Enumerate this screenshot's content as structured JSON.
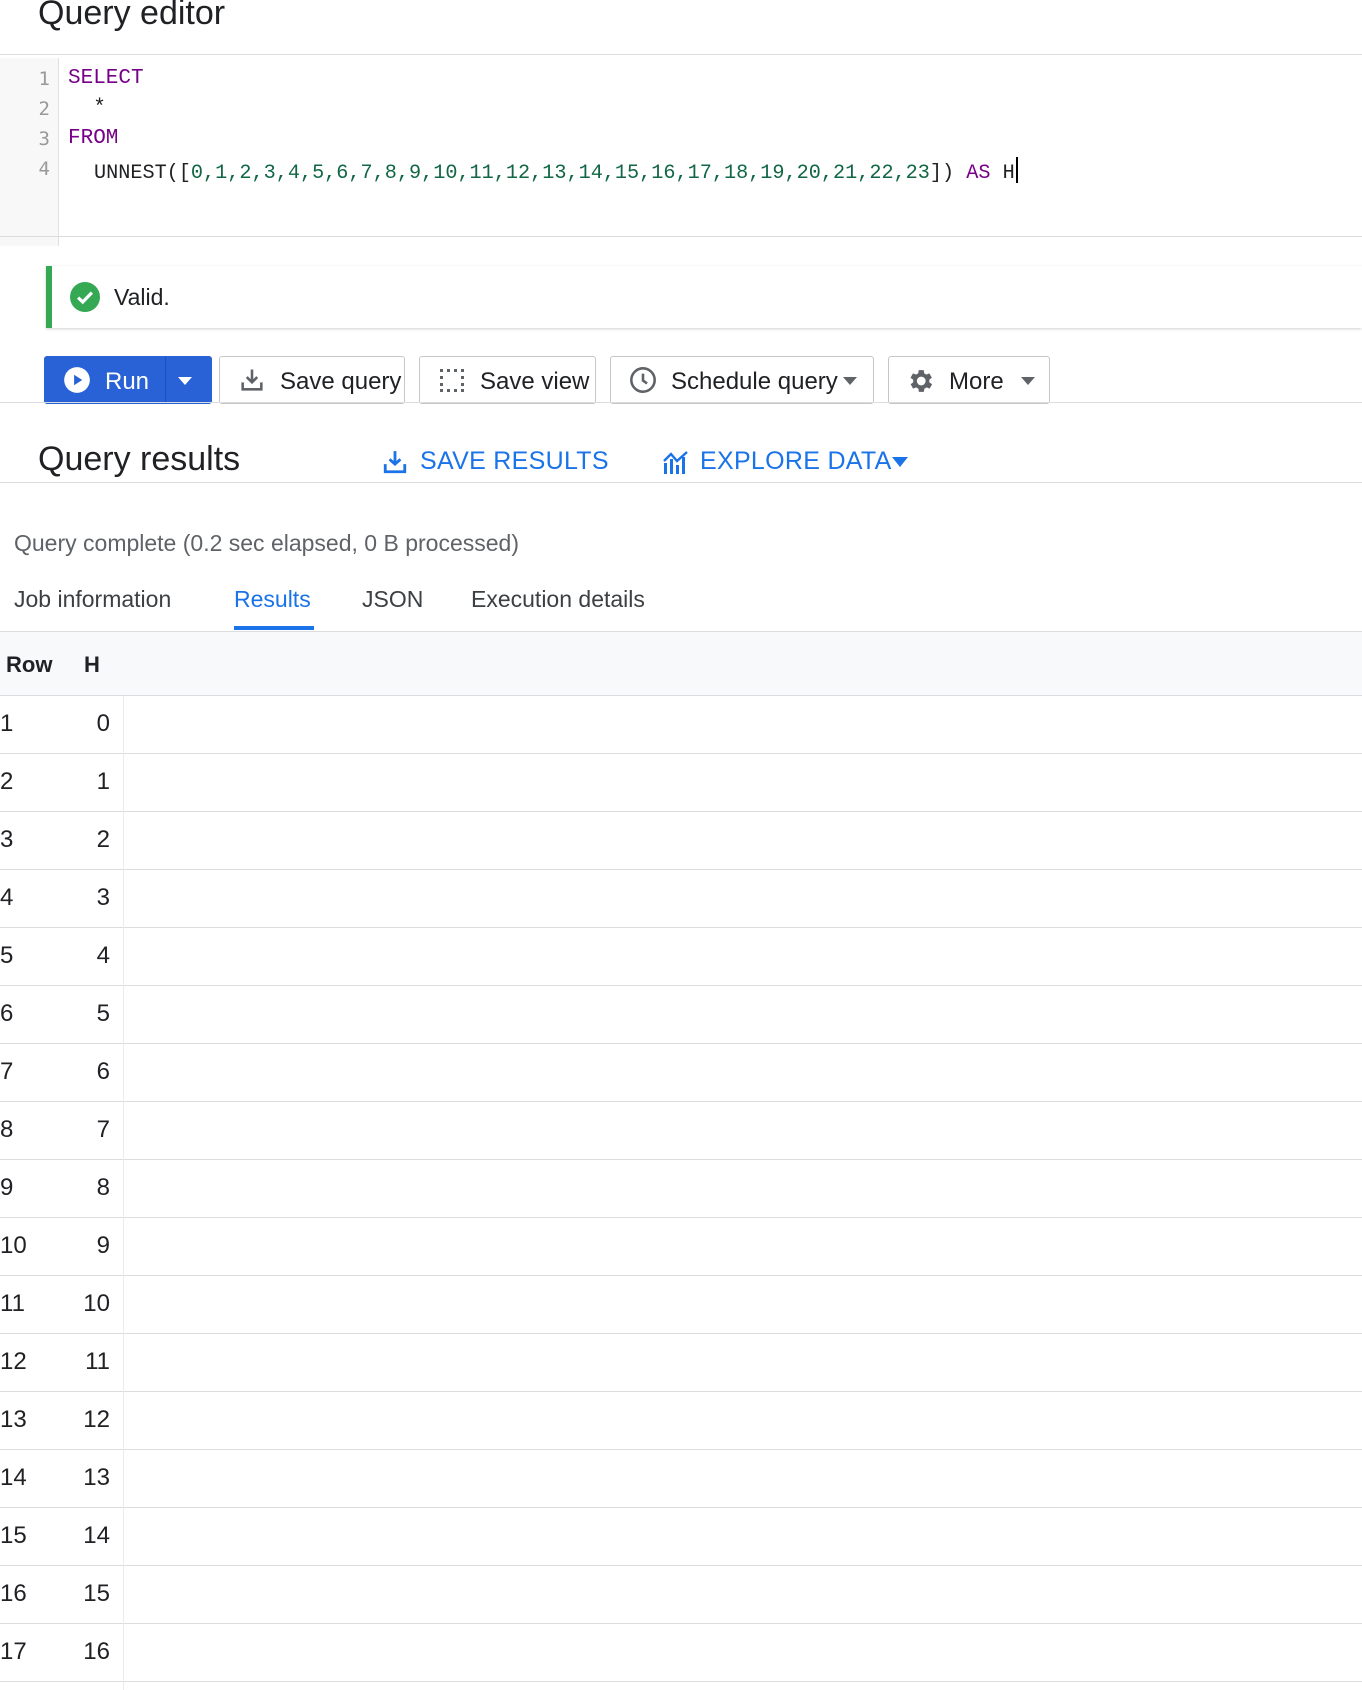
{
  "editor": {
    "title": "Query editor",
    "line_numbers": [
      "1",
      "2",
      "3",
      "4"
    ],
    "code": {
      "line1_kw": "SELECT",
      "line2": "*",
      "line3_kw": "FROM",
      "line4_fn": "UNNEST([",
      "line4_nums": "0,1,2,3,4,5,6,7,8,9,10,11,12,13,14,15,16,17,18,19,20,21,22,23",
      "line4_close": "])",
      "line4_as": "AS",
      "line4_alias": "H"
    }
  },
  "validation": {
    "text": "Valid.",
    "color": "#34a853"
  },
  "toolbar": {
    "run": "Run",
    "save_query": "Save query",
    "save_view": "Save view",
    "schedule_query": "Schedule query",
    "more": "More"
  },
  "results": {
    "title": "Query results",
    "save_results": "SAVE RESULTS",
    "explore_data": "EXPLORE DATA",
    "status": "Query complete (0.2 sec elapsed, 0 B processed)",
    "tabs": [
      "Job information",
      "Results",
      "JSON",
      "Execution details"
    ],
    "active_tab": "Results",
    "columns": [
      "Row",
      "H"
    ],
    "rows": [
      [
        "1",
        "0"
      ],
      [
        "2",
        "1"
      ],
      [
        "3",
        "2"
      ],
      [
        "4",
        "3"
      ],
      [
        "5",
        "4"
      ],
      [
        "6",
        "5"
      ],
      [
        "7",
        "6"
      ],
      [
        "8",
        "7"
      ],
      [
        "9",
        "8"
      ],
      [
        "10",
        "9"
      ],
      [
        "11",
        "10"
      ],
      [
        "12",
        "11"
      ],
      [
        "13",
        "12"
      ],
      [
        "14",
        "13"
      ],
      [
        "15",
        "14"
      ],
      [
        "16",
        "15"
      ],
      [
        "17",
        "16"
      ]
    ]
  },
  "colors": {
    "accent": "#1a73e8",
    "run_button": "#2962d6",
    "keyword": "#770088",
    "number": "#116644"
  }
}
